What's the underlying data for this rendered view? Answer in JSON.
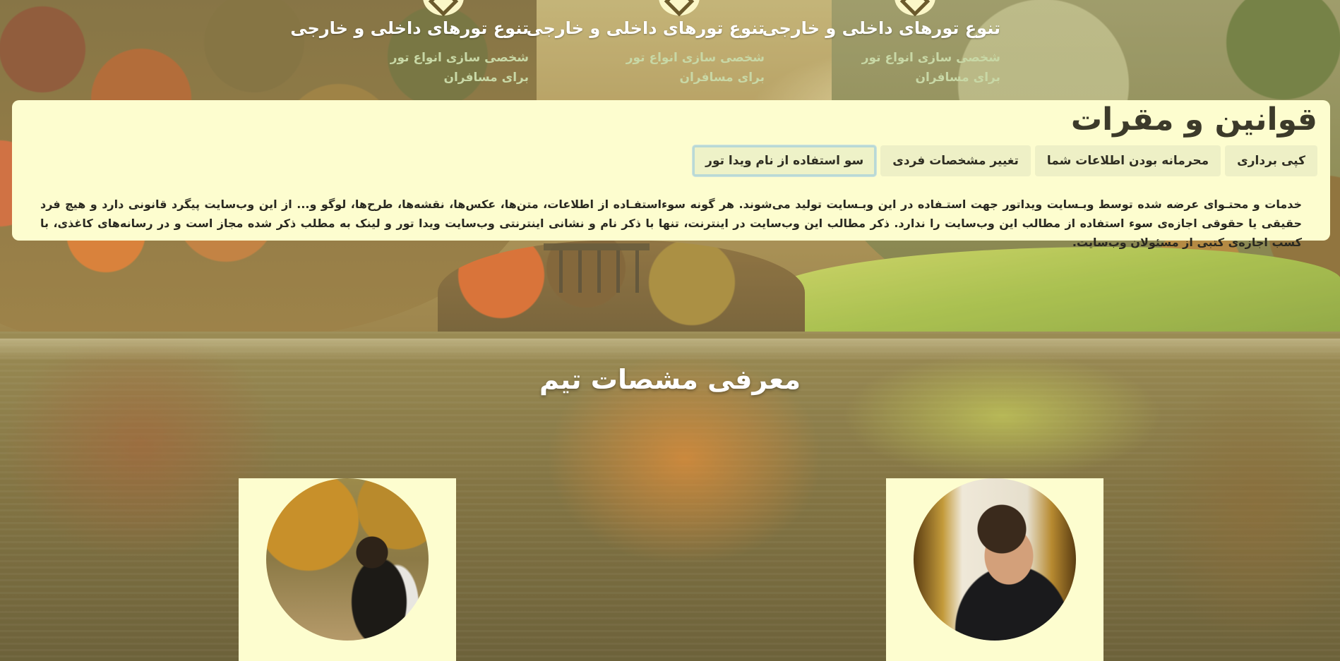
{
  "features": [
    {
      "title": "تنوع تورهای داخلی و خارجی",
      "desc": "شخصی سازی انواع تور برای مسافران",
      "icon": "diamond-icon"
    },
    {
      "title": "تنوع تورهای داخلی و خارجی",
      "desc": "شخصی سازی انواع تور برای مسافران",
      "icon": "diamond-icon"
    },
    {
      "title": "تنوع تورهای داخلی و خارجی",
      "desc": "شخصی سازی انواع تور برای مسافران",
      "icon": "diamond-icon"
    }
  ],
  "terms": {
    "title": "قوانین و مقرات",
    "tabs": [
      {
        "label": "کپی برداری",
        "active": false
      },
      {
        "label": "محرمانه بودن اطلاعات شما",
        "active": false
      },
      {
        "label": "تغییر مشخصات فردی",
        "active": false
      },
      {
        "label": "سو استفاده از نام ویدا تور",
        "active": true
      }
    ],
    "body": "خدمات و محتـوای عرضه شده توسط وبـسایت ویداتور جهت استـفاده در این وبـسایت تولید می‌شوند. هر گونه سوءاستفـاده از اطلاعات، متن‌ها، عکس‌ها، نقشه‌ها، طرح‌ها، لوگو و... از این وب‌سایت پیگرد قانونی دارد و هیچ فرد حقیقی یا حقوقی اجازه‌ی سوء استفاده از مطالب این وب‌سایت را ندارد. ذکر مطالب این وب‌سایت در اینترنت، تنها با ذکر نام و نشانی اینترنتی وب‌سایت ویدا تور و لینک به مطلب ذکر شده مجاز است و در رسانه‌های کاغذی، با کسب اجازه‌ی کتبی از مسئولان وب‌سایت."
  },
  "team": {
    "title": "معرفی مشصات تیم"
  },
  "colors": {
    "panel": "#fdfdcf",
    "tab": "#eef0c6",
    "active_tab_border": "#b9d9d6",
    "heading_dark": "#3c3a2a",
    "feature_desc": "#c8d8a6"
  }
}
